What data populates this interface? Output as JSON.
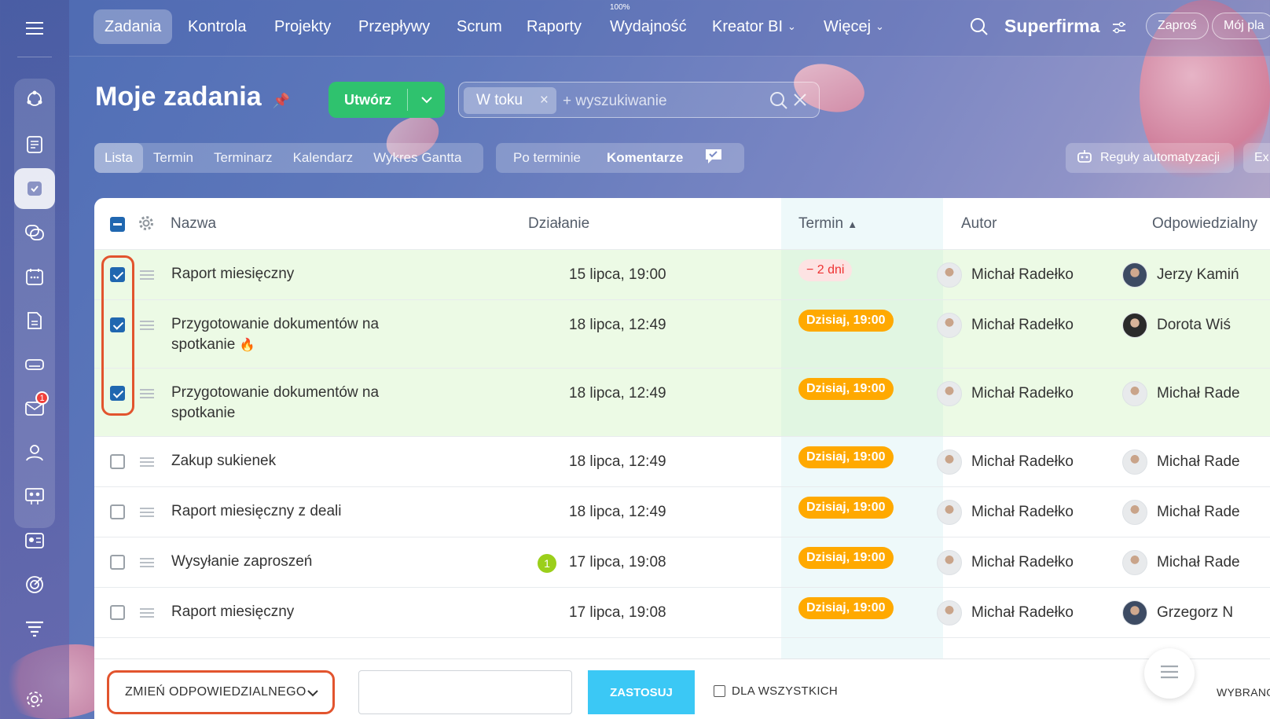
{
  "topnav": {
    "items": [
      "Zadania",
      "Kontrola",
      "Projekty",
      "Przepływy",
      "Scrum",
      "Raporty",
      "Wydajność",
      "Kreator BI",
      "Więcej"
    ],
    "efficiency_percent": "100%",
    "brand": "Superfirma",
    "invite_label": "Zaproś",
    "plan_label": "Mój pla"
  },
  "sidebar": {
    "icons": [
      "menu-icon",
      "sitemap-icon",
      "news-icon",
      "tasks-icon",
      "chat-icon",
      "calendar-icon",
      "document-icon",
      "drive-icon",
      "mail-icon",
      "contacts-icon",
      "workgroups-icon",
      "crm-icon",
      "marketing-icon",
      "funnel-icon",
      "settings-icon"
    ],
    "mail_badge": "1"
  },
  "page": {
    "title": "Moje zadania",
    "create_label": "Utwórz",
    "filter_chip": "W toku",
    "search_placeholder": "+ wyszukiwanie"
  },
  "views": {
    "tabs": [
      "Lista",
      "Termin",
      "Terminarz",
      "Kalendarz",
      "Wykres Gantta"
    ],
    "filters": [
      "Po terminie",
      "Komentarze"
    ],
    "rules_label": "Reguły automatyzacji",
    "extra_label": "Ex"
  },
  "table": {
    "headers": {
      "name": "Nazwa",
      "activity": "Działanie",
      "due": "Termin",
      "author": "Autor",
      "responsible": "Odpowiedzialny"
    },
    "rows": [
      {
        "name": "Raport miesięczny",
        "activity": "15 lipca, 19:00",
        "due": "− 2 dni",
        "due_type": "overdue",
        "author": "Michał Radełko",
        "responsible": "Jerzy Kamiń",
        "checked": true
      },
      {
        "name": "Przygotowanie dokumentów na spotkanie",
        "activity": "18 lipca, 12:49",
        "due": "Dzisiaj, 19:00",
        "due_type": "today",
        "author": "Michał Radełko",
        "responsible": "Dorota Wiś",
        "checked": true,
        "hot": true
      },
      {
        "name": "Przygotowanie dokumentów na spotkanie",
        "activity": "18 lipca, 12:49",
        "due": "Dzisiaj, 19:00",
        "due_type": "today",
        "author": "Michał Radełko",
        "responsible": "Michał Rade",
        "checked": true
      },
      {
        "name": "Zakup sukienek",
        "activity": "18 lipca, 12:49",
        "due": "Dzisiaj, 19:00",
        "due_type": "today",
        "author": "Michał Radełko",
        "responsible": "Michał Rade",
        "checked": false
      },
      {
        "name": "Raport miesięczny z deali",
        "activity": "18 lipca, 12:49",
        "due": "Dzisiaj, 19:00",
        "due_type": "today",
        "author": "Michał Radełko",
        "responsible": "Michał Rade",
        "checked": false
      },
      {
        "name": "Wysyłanie zaproszeń",
        "activity": "17 lipca, 19:08",
        "activity_badge": "1",
        "due": "Dzisiaj, 19:00",
        "due_type": "today",
        "author": "Michał Radełko",
        "responsible": "Michał Rade",
        "checked": false
      },
      {
        "name": "Raport miesięczny",
        "activity": "17 lipca, 19:08",
        "due": "Dzisiaj, 19:00",
        "due_type": "today",
        "author": "Michał Radełko",
        "responsible": "Grzegorz N",
        "checked": false
      }
    ]
  },
  "footer": {
    "action_select": "ZMIEŃ ODPOWIEDZIALNEGO",
    "apply_label": "ZASTOSUJ",
    "for_all_label": "DLA WSZYSTKICH",
    "selected_label": "WYBRANO"
  },
  "colors": {
    "accent_green": "#2fc26e",
    "due_today": "#ffa900",
    "apply_blue": "#3bc8f5",
    "highlight_red": "#e2542e"
  }
}
